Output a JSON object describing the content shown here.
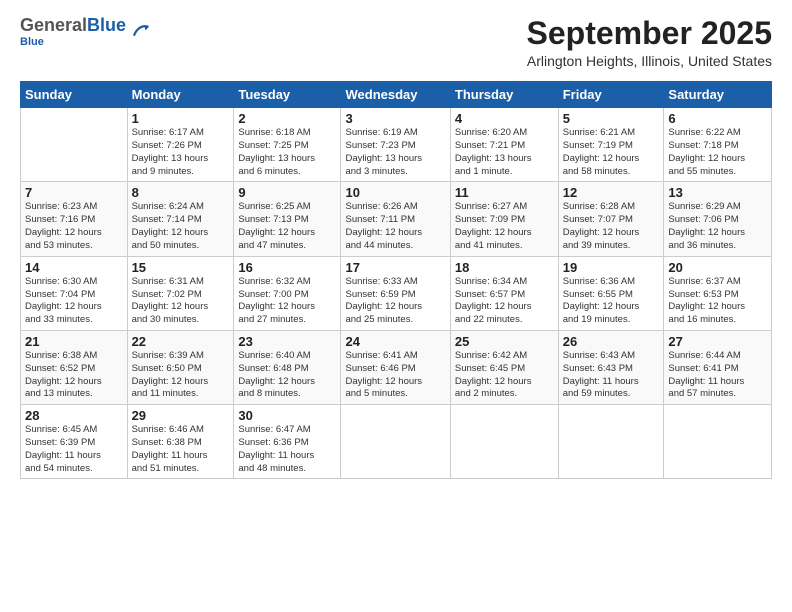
{
  "logo": {
    "general": "General",
    "blue": "Blue",
    "line": "Blue"
  },
  "header": {
    "title": "September 2025",
    "location": "Arlington Heights, Illinois, United States"
  },
  "days": [
    "Sunday",
    "Monday",
    "Tuesday",
    "Wednesday",
    "Thursday",
    "Friday",
    "Saturday"
  ],
  "weeks": [
    [
      {
        "num": "",
        "info": ""
      },
      {
        "num": "1",
        "info": "Sunrise: 6:17 AM\nSunset: 7:26 PM\nDaylight: 13 hours\nand 9 minutes."
      },
      {
        "num": "2",
        "info": "Sunrise: 6:18 AM\nSunset: 7:25 PM\nDaylight: 13 hours\nand 6 minutes."
      },
      {
        "num": "3",
        "info": "Sunrise: 6:19 AM\nSunset: 7:23 PM\nDaylight: 13 hours\nand 3 minutes."
      },
      {
        "num": "4",
        "info": "Sunrise: 6:20 AM\nSunset: 7:21 PM\nDaylight: 13 hours\nand 1 minute."
      },
      {
        "num": "5",
        "info": "Sunrise: 6:21 AM\nSunset: 7:19 PM\nDaylight: 12 hours\nand 58 minutes."
      },
      {
        "num": "6",
        "info": "Sunrise: 6:22 AM\nSunset: 7:18 PM\nDaylight: 12 hours\nand 55 minutes."
      }
    ],
    [
      {
        "num": "7",
        "info": "Sunrise: 6:23 AM\nSunset: 7:16 PM\nDaylight: 12 hours\nand 53 minutes."
      },
      {
        "num": "8",
        "info": "Sunrise: 6:24 AM\nSunset: 7:14 PM\nDaylight: 12 hours\nand 50 minutes."
      },
      {
        "num": "9",
        "info": "Sunrise: 6:25 AM\nSunset: 7:13 PM\nDaylight: 12 hours\nand 47 minutes."
      },
      {
        "num": "10",
        "info": "Sunrise: 6:26 AM\nSunset: 7:11 PM\nDaylight: 12 hours\nand 44 minutes."
      },
      {
        "num": "11",
        "info": "Sunrise: 6:27 AM\nSunset: 7:09 PM\nDaylight: 12 hours\nand 41 minutes."
      },
      {
        "num": "12",
        "info": "Sunrise: 6:28 AM\nSunset: 7:07 PM\nDaylight: 12 hours\nand 39 minutes."
      },
      {
        "num": "13",
        "info": "Sunrise: 6:29 AM\nSunset: 7:06 PM\nDaylight: 12 hours\nand 36 minutes."
      }
    ],
    [
      {
        "num": "14",
        "info": "Sunrise: 6:30 AM\nSunset: 7:04 PM\nDaylight: 12 hours\nand 33 minutes."
      },
      {
        "num": "15",
        "info": "Sunrise: 6:31 AM\nSunset: 7:02 PM\nDaylight: 12 hours\nand 30 minutes."
      },
      {
        "num": "16",
        "info": "Sunrise: 6:32 AM\nSunset: 7:00 PM\nDaylight: 12 hours\nand 27 minutes."
      },
      {
        "num": "17",
        "info": "Sunrise: 6:33 AM\nSunset: 6:59 PM\nDaylight: 12 hours\nand 25 minutes."
      },
      {
        "num": "18",
        "info": "Sunrise: 6:34 AM\nSunset: 6:57 PM\nDaylight: 12 hours\nand 22 minutes."
      },
      {
        "num": "19",
        "info": "Sunrise: 6:36 AM\nSunset: 6:55 PM\nDaylight: 12 hours\nand 19 minutes."
      },
      {
        "num": "20",
        "info": "Sunrise: 6:37 AM\nSunset: 6:53 PM\nDaylight: 12 hours\nand 16 minutes."
      }
    ],
    [
      {
        "num": "21",
        "info": "Sunrise: 6:38 AM\nSunset: 6:52 PM\nDaylight: 12 hours\nand 13 minutes."
      },
      {
        "num": "22",
        "info": "Sunrise: 6:39 AM\nSunset: 6:50 PM\nDaylight: 12 hours\nand 11 minutes."
      },
      {
        "num": "23",
        "info": "Sunrise: 6:40 AM\nSunset: 6:48 PM\nDaylight: 12 hours\nand 8 minutes."
      },
      {
        "num": "24",
        "info": "Sunrise: 6:41 AM\nSunset: 6:46 PM\nDaylight: 12 hours\nand 5 minutes."
      },
      {
        "num": "25",
        "info": "Sunrise: 6:42 AM\nSunset: 6:45 PM\nDaylight: 12 hours\nand 2 minutes."
      },
      {
        "num": "26",
        "info": "Sunrise: 6:43 AM\nSunset: 6:43 PM\nDaylight: 11 hours\nand 59 minutes."
      },
      {
        "num": "27",
        "info": "Sunrise: 6:44 AM\nSunset: 6:41 PM\nDaylight: 11 hours\nand 57 minutes."
      }
    ],
    [
      {
        "num": "28",
        "info": "Sunrise: 6:45 AM\nSunset: 6:39 PM\nDaylight: 11 hours\nand 54 minutes."
      },
      {
        "num": "29",
        "info": "Sunrise: 6:46 AM\nSunset: 6:38 PM\nDaylight: 11 hours\nand 51 minutes."
      },
      {
        "num": "30",
        "info": "Sunrise: 6:47 AM\nSunset: 6:36 PM\nDaylight: 11 hours\nand 48 minutes."
      },
      {
        "num": "",
        "info": ""
      },
      {
        "num": "",
        "info": ""
      },
      {
        "num": "",
        "info": ""
      },
      {
        "num": "",
        "info": ""
      }
    ]
  ]
}
